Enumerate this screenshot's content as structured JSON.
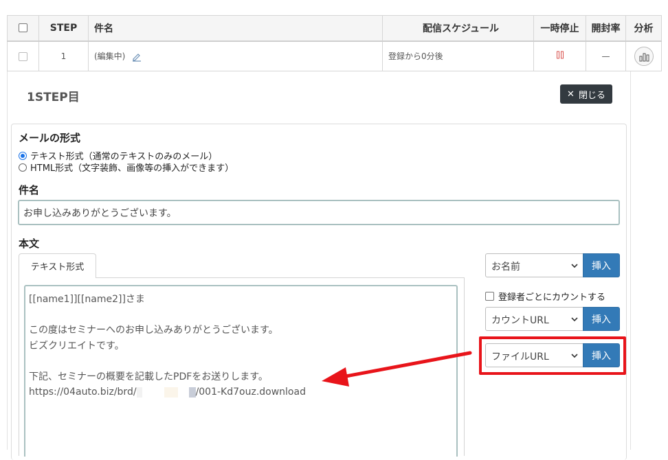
{
  "table": {
    "headers": [
      "",
      "STEP",
      "件名",
      "配信スケジュール",
      "一時停止",
      "開封率",
      "分析"
    ],
    "row": {
      "step": "1",
      "subject": "(編集中)",
      "schedule": "登録から0分後",
      "pause_icon": "pause-icon",
      "open_rate": "—",
      "analysis_icon": "bar-chart-icon"
    }
  },
  "step_panel": {
    "title": "1STEP目",
    "close_label": "閉じる",
    "mail_format": {
      "heading": "メールの形式",
      "options": [
        {
          "label": "テキスト形式（通常のテキストのみのメール）",
          "selected": true
        },
        {
          "label": "HTML形式（文字装飾、画像等の挿入ができます）",
          "selected": false
        }
      ]
    },
    "subject": {
      "heading": "件名",
      "value": "お申し込みありがとうございます。"
    },
    "body": {
      "heading": "本文",
      "tab_label": "テキスト形式",
      "lines": [
        "[[name1]][[name2]]さま",
        "",
        "この度はセミナーへのお申し込みありがとうございます。",
        "ビズクリエイトです。",
        "",
        "下記、セミナーの概要を記載したPDFをお送りします。"
      ],
      "url_prefix": "https://04auto.biz/brd/",
      "url_suffix": "/001-Kd7ouz.download"
    },
    "inserts": {
      "name_select": "お名前",
      "insert_label": "挿入",
      "count_checkbox_label": "登録者ごとにカウントする",
      "count_select": "カウントURL",
      "file_select": "ファイルURL"
    }
  },
  "colors": {
    "insert_button": "#337ab7",
    "highlight": "#e8141a",
    "close_button": "#333a40"
  }
}
